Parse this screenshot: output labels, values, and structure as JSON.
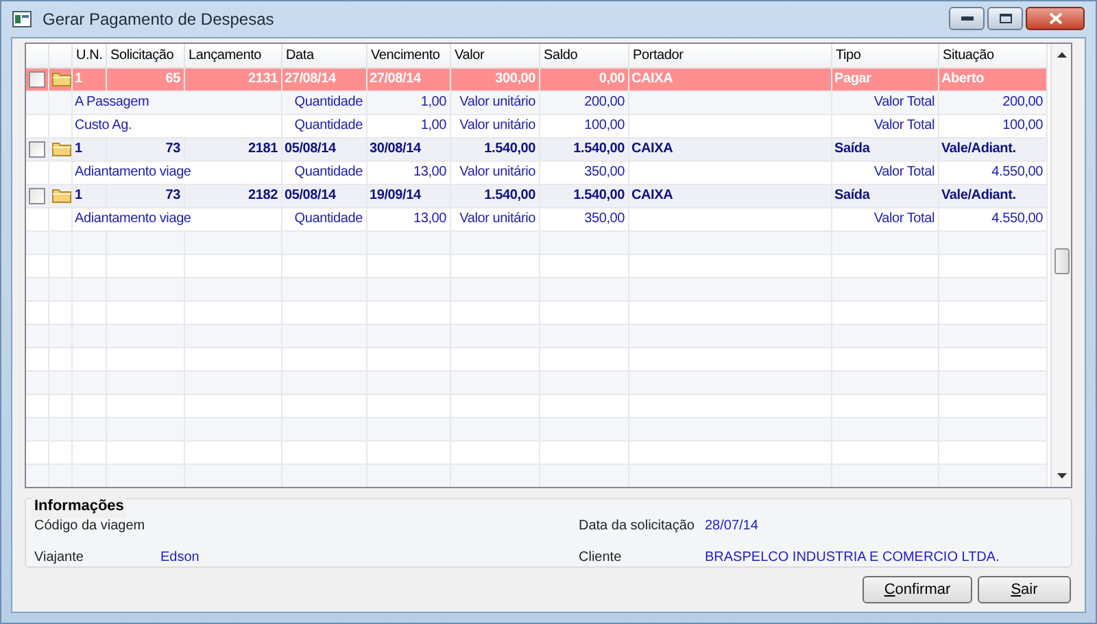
{
  "window": {
    "title": "Gerar Pagamento de Despesas"
  },
  "table": {
    "columns": [
      "U.N.",
      "Solicitação",
      "Lançamento",
      "Data",
      "Vencimento",
      "Valor",
      "Saldo",
      "Portador",
      "Tipo",
      "Situação"
    ],
    "rows": [
      {
        "kind": "main",
        "highlighted": true,
        "checked": false,
        "un": "1",
        "solicitacao": "65",
        "lancamento": "2131",
        "data": "27/08/14",
        "vencimento": "27/08/14",
        "valor": "300,00",
        "saldo": "0,00",
        "portador": "CAIXA",
        "tipo": "Pagar",
        "situacao": "Aberto"
      },
      {
        "kind": "detail",
        "description": "A Passagem",
        "quantity_label": "Quantidade",
        "quantity": "1,00",
        "unit_label": "Valor unitário",
        "unit_value": "200,00",
        "total_label": "Valor Total",
        "total": "200,00"
      },
      {
        "kind": "detail",
        "description": "Custo Ag.",
        "quantity_label": "Quantidade",
        "quantity": "1,00",
        "unit_label": "Valor unitário",
        "unit_value": "100,00",
        "total_label": "Valor Total",
        "total": "100,00"
      },
      {
        "kind": "main",
        "highlighted": false,
        "checked": false,
        "un": "1",
        "solicitacao": "73",
        "lancamento": "2181",
        "data": "05/08/14",
        "vencimento": "30/08/14",
        "valor": "1.540,00",
        "saldo": "1.540,00",
        "portador": "CAIXA",
        "tipo": "Saída",
        "situacao": "Vale/Adiant."
      },
      {
        "kind": "detail",
        "description": "Adiantamento viage",
        "quantity_label": "Quantidade",
        "quantity": "13,00",
        "unit_label": "Valor unitário",
        "unit_value": "350,00",
        "total_label": "Valor Total",
        "total": "4.550,00"
      },
      {
        "kind": "main",
        "highlighted": false,
        "checked": false,
        "un": "1",
        "solicitacao": "73",
        "lancamento": "2182",
        "data": "05/08/14",
        "vencimento": "19/09/14",
        "valor": "1.540,00",
        "saldo": "1.540,00",
        "portador": "CAIXA",
        "tipo": "Saída",
        "situacao": "Vale/Adiant."
      },
      {
        "kind": "detail",
        "description": "Adiantamento viage",
        "quantity_label": "Quantidade",
        "quantity": "13,00",
        "unit_label": "Valor unitário",
        "unit_value": "350,00",
        "total_label": "Valor Total",
        "total": "4.550,00"
      }
    ]
  },
  "info": {
    "title": "Informações",
    "fields": [
      {
        "label": "Código da viagem"
      },
      {
        "label": "Data da solicitação",
        "value": "28/07/14"
      },
      {
        "label": "Viajante",
        "value": "Edson"
      },
      {
        "label": "Cliente",
        "value": "BRASPELCO INDUSTRIA E COMERCIO LTDA."
      }
    ]
  },
  "buttons": [
    "Confirmar",
    "Sair"
  ]
}
